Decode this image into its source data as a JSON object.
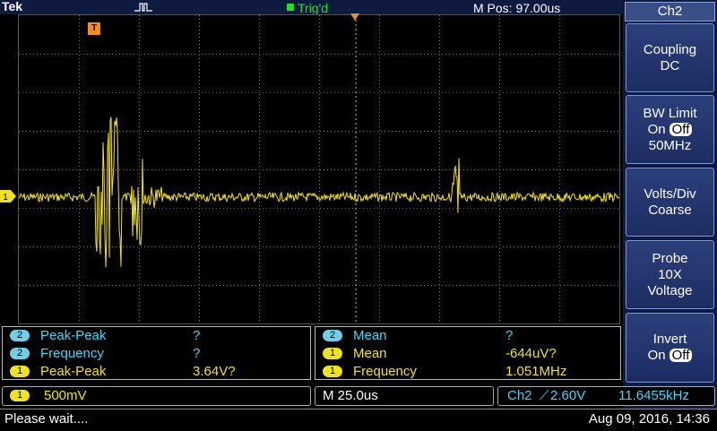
{
  "header": {
    "brand": "Tek",
    "trigger_status": "Trig'd",
    "horizontal_position": "M Pos: 97.00us"
  },
  "channel_marker": "1",
  "trigger_marker": "T",
  "menu": {
    "title": "Ch2",
    "buttons": [
      {
        "line1": "Coupling",
        "line2": "DC"
      },
      {
        "line1": "BW Limit",
        "line2_prefix": "On",
        "line2_toggle": "Off",
        "line3": "50MHz"
      },
      {
        "line1": "Volts/Div",
        "line2": "Coarse"
      },
      {
        "line1": "Probe",
        "line2": "10X",
        "line3": "Voltage"
      },
      {
        "line1": "Invert",
        "line2_prefix": "On",
        "line2_toggle": "Off"
      }
    ]
  },
  "measurements_left": [
    {
      "channel": "2",
      "name": "Peak-Peak",
      "value": "?",
      "color": "#49d5f2"
    },
    {
      "channel": "2",
      "name": "Frequency",
      "value": "?",
      "color": "#49d5f2"
    },
    {
      "channel": "1",
      "name": "Peak-Peak",
      "value": "3.64V?",
      "color": "#f0e21e"
    }
  ],
  "measurements_right": [
    {
      "channel": "2",
      "name": "Mean",
      "value": "?",
      "color": "#49d5f2"
    },
    {
      "channel": "1",
      "name": "Mean",
      "value": "-644uV?",
      "color": "#f0e21e"
    },
    {
      "channel": "1",
      "name": "Frequency",
      "value": "1.051MHz",
      "color": "#f0e21e"
    }
  ],
  "bottom": {
    "ch1_badge": "1",
    "ch1_scale": "500mV",
    "timebase": "M 25.0us",
    "trigger_source": "Ch2",
    "trigger_slope_symbol": "⟋",
    "trigger_level": "2.60V",
    "trigger_frequency": "11.6455kHz"
  },
  "status": {
    "message": "Please wait....",
    "datetime": "Aug 09, 2016, 14:36"
  },
  "colors": {
    "ch1": "#f0e21e",
    "ch2": "#49d5f2",
    "trigger": "#f08c1e",
    "trig_status": "#19e619"
  }
}
